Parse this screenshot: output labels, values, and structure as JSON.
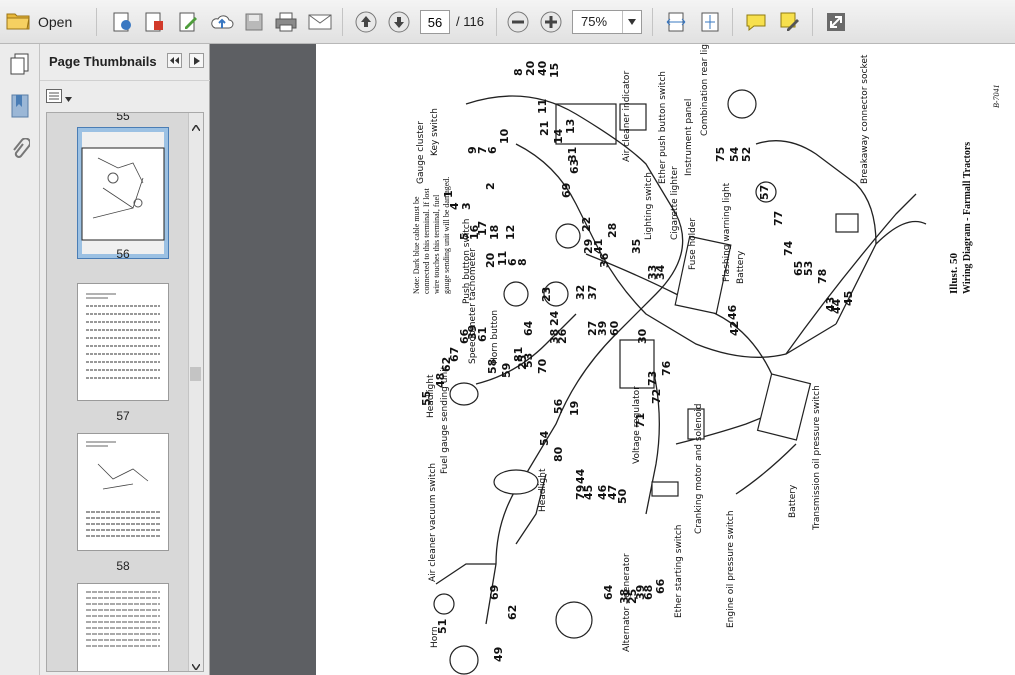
{
  "toolbar": {
    "open_label": "Open",
    "page_current": "56",
    "page_total": "/ 116",
    "zoom": "75%"
  },
  "panel": {
    "title": "Page Thumbnails",
    "thumbs": [
      {
        "label": "55"
      },
      {
        "label": "56"
      },
      {
        "label": "57"
      },
      {
        "label": "58"
      }
    ]
  },
  "diagram": {
    "title": "Illust. 50",
    "subtitle": "Wiring Diagram - Farmall Tractors",
    "code": "B-7041",
    "note": "Note: Dark blue cable must be connected to this terminal. If lost wire touches this terminal, fuel gauge sending unit will be damaged.",
    "labels": {
      "gauge_cluster": "Gauge cluster",
      "key_switch": "Key switch",
      "air_cleaner_indicator": "Air cleaner indicator",
      "ether_push_button": "Ether push button switch",
      "instrument_panel": "Instrument panel",
      "combination_rear_light": "Combination rear light",
      "breakaway_socket": "Breakaway connector socket",
      "lighting_switch": "Lighting switch",
      "cigarette_lighter": "Cigarette lighter",
      "fuse_holder": "Fuse holder",
      "flashing_warning_light": "Flashing warning light",
      "push_button_switch": "Push button switch",
      "speedometer": "Speedometer tachometer",
      "horn_button": "Horn button",
      "battery": "Battery",
      "headlight": "Headlight",
      "fuel_gauge": "Fuel gauge sending unit",
      "voltage_regulator": "Voltage regulator",
      "air_cleaner_vacuum": "Air cleaner vacuum switch",
      "cranking_motor": "Cranking motor and solenoid",
      "transmission_oil": "Transmission oil pressure switch",
      "ether_starting": "Ether starting switch",
      "engine_oil": "Engine oil pressure switch",
      "alternator": "Alternator - generator",
      "horn": "Horn"
    },
    "numbers": [
      "8",
      "20",
      "40",
      "15",
      "11",
      "21",
      "14",
      "13",
      "9",
      "7",
      "6",
      "10",
      "2",
      "1",
      "4",
      "3",
      "5",
      "16",
      "17",
      "18",
      "12",
      "20",
      "11",
      "6",
      "8",
      "31",
      "63",
      "69",
      "22",
      "29",
      "28",
      "41",
      "36",
      "35",
      "33",
      "34",
      "30",
      "25",
      "23",
      "24",
      "32",
      "37",
      "38",
      "26",
      "27",
      "39",
      "60",
      "64",
      "55",
      "48",
      "62",
      "67",
      "66",
      "39",
      "61",
      "58",
      "59",
      "81",
      "53",
      "70",
      "56",
      "54",
      "19",
      "80",
      "44",
      "79",
      "45",
      "46",
      "47",
      "50",
      "71",
      "72",
      "73",
      "76",
      "75",
      "54",
      "52",
      "57",
      "77",
      "74",
      "65",
      "53",
      "78",
      "43",
      "44",
      "45",
      "46",
      "42",
      "38",
      "25",
      "39",
      "68",
      "66",
      "69",
      "62",
      "64",
      "51",
      "49"
    ]
  }
}
